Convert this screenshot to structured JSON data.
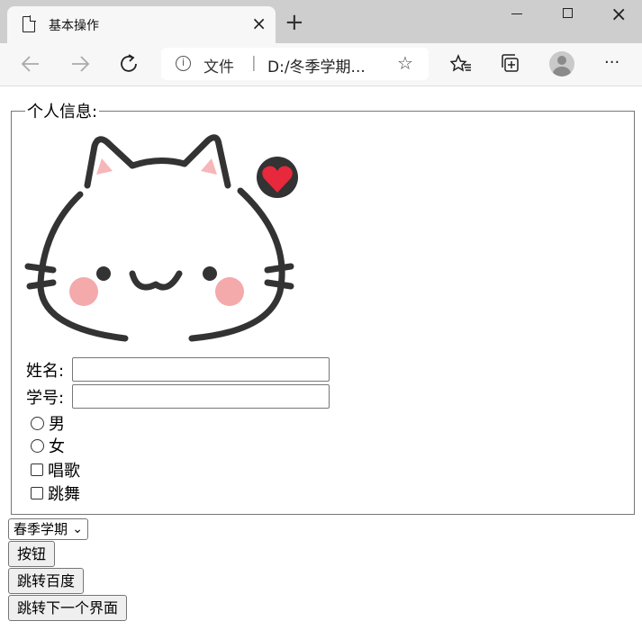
{
  "window": {
    "tab_title": "基本操作",
    "tab_close": "×",
    "new_tab": "+",
    "close": "×"
  },
  "toolbar": {
    "address_label": "文件",
    "address_sep": "|",
    "address_url": "D:/冬季学期...",
    "more": "···"
  },
  "form": {
    "legend": "个人信息:",
    "name_label": "姓名:",
    "name_value": "",
    "id_label": "学号:",
    "id_value": "",
    "gender_options": [
      "男",
      "女"
    ],
    "hobby_options": [
      "唱歌",
      "跳舞"
    ]
  },
  "select": {
    "selected": "春季学期"
  },
  "buttons": {
    "button": "按钮",
    "baidu": "跳转百度",
    "next_page": "跳转下一个界面"
  },
  "colors": {
    "heart": "#e8283c",
    "blush": "#f4a9ab",
    "ear": "#f7b6b8",
    "outline": "#333333"
  }
}
